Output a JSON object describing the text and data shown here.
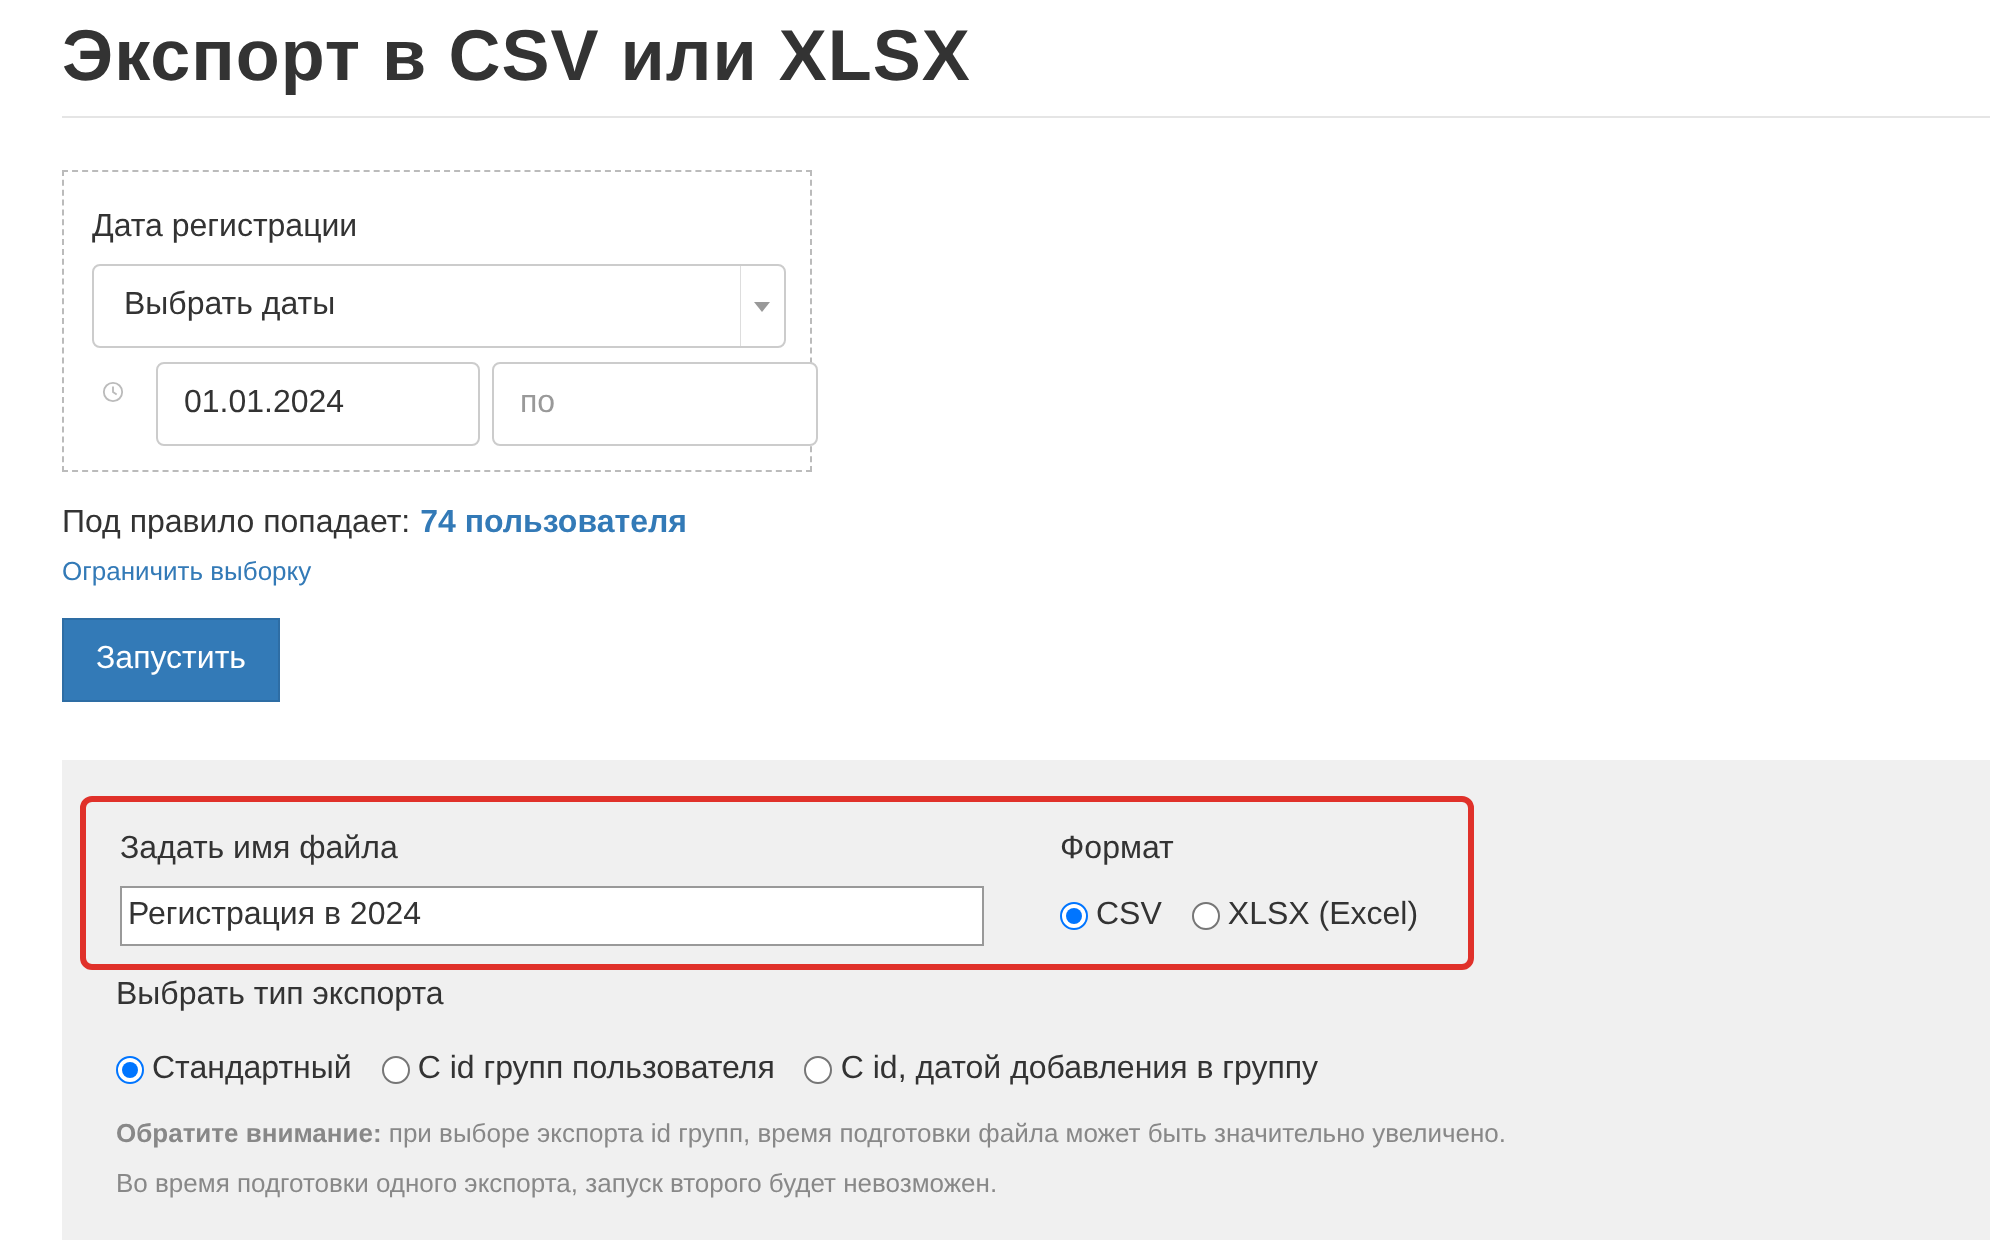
{
  "title": "Экспорт в CSV или XLSX",
  "date_filter": {
    "label": "Дата регистрации",
    "select_value": "Выбрать даты",
    "from_value": "01.01.2024",
    "to_placeholder": "по"
  },
  "rule_summary": {
    "text": "Под правило попадает:",
    "count": "74 пользователя"
  },
  "limit_link": "Ограничить выборку",
  "run_button": "Запустить",
  "export": {
    "highlighted": true,
    "file_name": {
      "label": "Задать имя файла",
      "value": "Регистрация в 2024"
    },
    "format": {
      "label": "Формат",
      "options": [
        {
          "label": "CSV",
          "selected": true
        },
        {
          "label": "XLSX (Excel)",
          "selected": false
        }
      ]
    },
    "export_type": {
      "label": "Выбрать тип экспорта",
      "options": [
        {
          "label": "Стандартный",
          "selected": true
        },
        {
          "label": "С id групп пользователя",
          "selected": false
        },
        {
          "label": "С id, датой добавления в группу",
          "selected": false
        }
      ]
    },
    "notes": [
      "**Обратите внимание:** при выборе экспорта id групп, время подготовки файла может быть значительно увеличено.",
      "Во время подготовки одного экспорта, запуск второго будет невозможен."
    ]
  }
}
